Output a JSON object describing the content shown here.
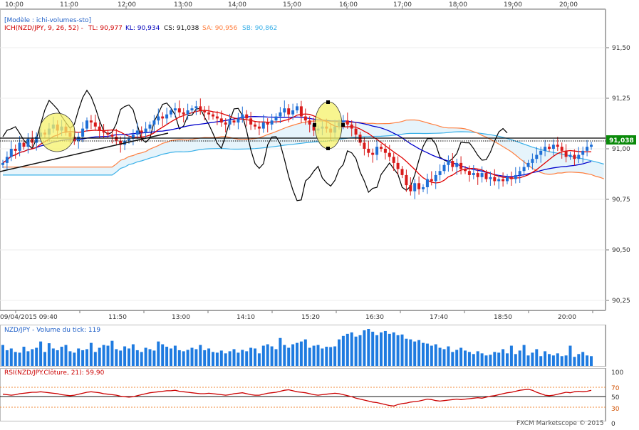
{
  "top_time_axis": {
    "labels": [
      "10:00",
      "11:00",
      "12:00",
      "13:00",
      "14:00",
      "15:00",
      "16:00",
      "17:00",
      "18:00",
      "19:00",
      "20:00"
    ]
  },
  "bottom_time_axis": {
    "labels": [
      "09/04/2015 09:40",
      "11:50",
      "13:00",
      "14:10",
      "15:20",
      "16:30",
      "17:40",
      "18:50",
      "20:00"
    ]
  },
  "price_axis": {
    "ticks": [
      "91,50",
      "91,25",
      "91,00",
      "90,75",
      "90,50",
      "90,25"
    ],
    "current": "91,038"
  },
  "legend": {
    "model": "[Modèle : ichi-volumes-sto]",
    "ich": "ICH(NZD/JPY, 9, 26, 52)  -",
    "tl": "TL: 90,977",
    "kl": "KL: 90,934",
    "cs": "CS: 91,038",
    "sa": "SA: 90,956",
    "sb": "SB: 90,862"
  },
  "volume_panel": {
    "title": "NZD/JPY - Volume du tick: 119"
  },
  "rsi_panel": {
    "title": "RSI(NZD/JPY.Clôture, 21): 59,90",
    "levels": [
      "100",
      "70",
      "50",
      "30",
      "0"
    ]
  },
  "footer": {
    "credit": "FXCM Marketscope © 2015"
  },
  "colors": {
    "tenkan": "#e00000",
    "kijun": "#0000cc",
    "chikou": "#000000",
    "senkou_a": "#ff7f3f",
    "senkou_b": "#3ab0e8",
    "cloud": "#e6f4fb",
    "bull": "#1f6fd6",
    "bear": "#d81b1b",
    "volume": "#1f7be0",
    "rsi": "#cc0000",
    "highlight": "#f6f16a"
  },
  "chart_data": [
    {
      "type": "candlestick",
      "title": "ICH(NZD/JPY, 9, 26, 52)",
      "ylim": [
        90.2,
        91.7
      ],
      "y_ticks": [
        91.5,
        91.25,
        91.0,
        90.75,
        90.5,
        90.25
      ],
      "current_price": 91.038,
      "x_start": "09/04/2015 09:40",
      "bar_interval_minutes": 5,
      "close": [
        90.93,
        90.96,
        91.0,
        90.99,
        91.03,
        91.01,
        91.05,
        91.03,
        91.06,
        91.08,
        91.07,
        91.1,
        91.12,
        91.09,
        91.11,
        91.08,
        91.06,
        91.04,
        91.06,
        91.1,
        91.14,
        91.13,
        91.11,
        91.09,
        91.08,
        91.07,
        91.06,
        91.04,
        91.02,
        91.04,
        91.05,
        91.07,
        91.09,
        91.08,
        91.1,
        91.12,
        91.14,
        91.16,
        91.15,
        91.17,
        91.19,
        91.2,
        91.18,
        91.17,
        91.19,
        91.2,
        91.21,
        91.19,
        91.18,
        91.17,
        91.16,
        91.15,
        91.13,
        91.12,
        91.14,
        91.13,
        91.15,
        91.17,
        91.15,
        91.12,
        91.11,
        91.1,
        91.13,
        91.12,
        91.14,
        91.16,
        91.18,
        91.2,
        91.17,
        91.19,
        91.21,
        91.16,
        91.14,
        91.12,
        91.09,
        91.1,
        91.11,
        91.1,
        91.08,
        91.11,
        91.13,
        91.14,
        91.12,
        91.1,
        91.07,
        91.03,
        91.0,
        90.98,
        90.97,
        91.01,
        91.0,
        90.98,
        90.96,
        90.93,
        90.9,
        90.87,
        90.82,
        90.79,
        90.83,
        90.8,
        90.81,
        90.85,
        90.84,
        90.87,
        90.89,
        90.92,
        90.94,
        90.91,
        90.93,
        90.9,
        90.89,
        90.87,
        90.88,
        90.86,
        90.88,
        90.85,
        90.86,
        90.84,
        90.85,
        90.84,
        90.86,
        90.85,
        90.87,
        90.89,
        90.91,
        90.93,
        90.95,
        90.97,
        90.99,
        91.01,
        91.0,
        91.02,
        91.01,
        90.99,
        90.96,
        90.97,
        90.95,
        90.97,
        90.99,
        91.01,
        91.02
      ],
      "tenkan": {
        "name": "TL",
        "last": 90.977
      },
      "kijun": {
        "name": "KL",
        "last": 90.934
      },
      "chikou": {
        "name": "CS",
        "last": 91.038
      },
      "senkou_a": {
        "name": "SA",
        "last": 90.956
      },
      "senkou_b": {
        "name": "SB",
        "last": 90.862
      }
    },
    {
      "type": "bar",
      "title": "NZD/JPY - Volume du tick",
      "last": 119,
      "values": [
        60,
        45,
        50,
        40,
        38,
        55,
        42,
        48,
        52,
        70,
        40,
        65,
        50,
        45,
        55,
        60,
        42,
        38,
        50,
        45,
        48,
        66,
        40,
        52,
        60,
        58,
        72,
        48,
        44,
        56,
        50,
        62,
        45,
        40,
        52,
        48,
        44,
        70,
        62,
        55,
        50,
        58,
        45,
        42,
        46,
        52,
        48,
        60,
        45,
        50,
        40,
        38,
        44,
        36,
        42,
        48,
        38,
        46,
        42,
        52,
        50,
        36,
        58,
        62,
        56,
        48,
        80,
        60,
        52,
        62,
        66,
        70,
        76,
        52,
        58,
        60,
        50,
        55,
        54,
        56,
        76,
        86,
        92,
        96,
        84,
        88,
        102,
        106,
        98,
        88,
        96,
        100,
        92,
        96,
        88,
        90,
        78,
        76,
        70,
        74,
        66,
        64,
        58,
        62,
        52,
        48,
        56,
        40,
        46,
        52,
        44,
        40,
        34,
        42,
        36,
        30,
        32,
        40,
        38,
        48,
        36,
        58,
        34,
        44,
        60,
        30,
        38,
        48,
        28,
        42,
        34,
        30,
        36,
        28,
        30,
        58,
        26,
        34,
        40,
        30,
        28
      ]
    },
    {
      "type": "line",
      "title": "RSI(NZD/JPY.Clôture, 21)",
      "last": 59.9,
      "ylim": [
        0,
        100
      ],
      "levels": [
        30,
        50,
        70
      ],
      "values": [
        54,
        53,
        52,
        53,
        55,
        56,
        57,
        58,
        58,
        59,
        58,
        57,
        56,
        55,
        53,
        52,
        51,
        52,
        54,
        56,
        58,
        59,
        58,
        57,
        55,
        54,
        53,
        52,
        50,
        49,
        48,
        49,
        51,
        53,
        55,
        57,
        58,
        59,
        60,
        61,
        61,
        62,
        60,
        59,
        58,
        57,
        56,
        55,
        55,
        56,
        55,
        54,
        53,
        52,
        53,
        55,
        56,
        57,
        55,
        53,
        52,
        52,
        54,
        56,
        57,
        58,
        60,
        62,
        63,
        61,
        59,
        58,
        57,
        55,
        53,
        52,
        53,
        54,
        55,
        56,
        55,
        53,
        51,
        49,
        46,
        44,
        42,
        40,
        38,
        37,
        35,
        33,
        31,
        30,
        33,
        35,
        36,
        38,
        39,
        40,
        42,
        44,
        43,
        41,
        40,
        41,
        42,
        43,
        44,
        43,
        44,
        45,
        46,
        47,
        46,
        48,
        50,
        51,
        53,
        55,
        57,
        58,
        60,
        62,
        63,
        64,
        62,
        58,
        55,
        52,
        51,
        52,
        54,
        56,
        58,
        57,
        59,
        60,
        59,
        60,
        62
      ]
    }
  ]
}
